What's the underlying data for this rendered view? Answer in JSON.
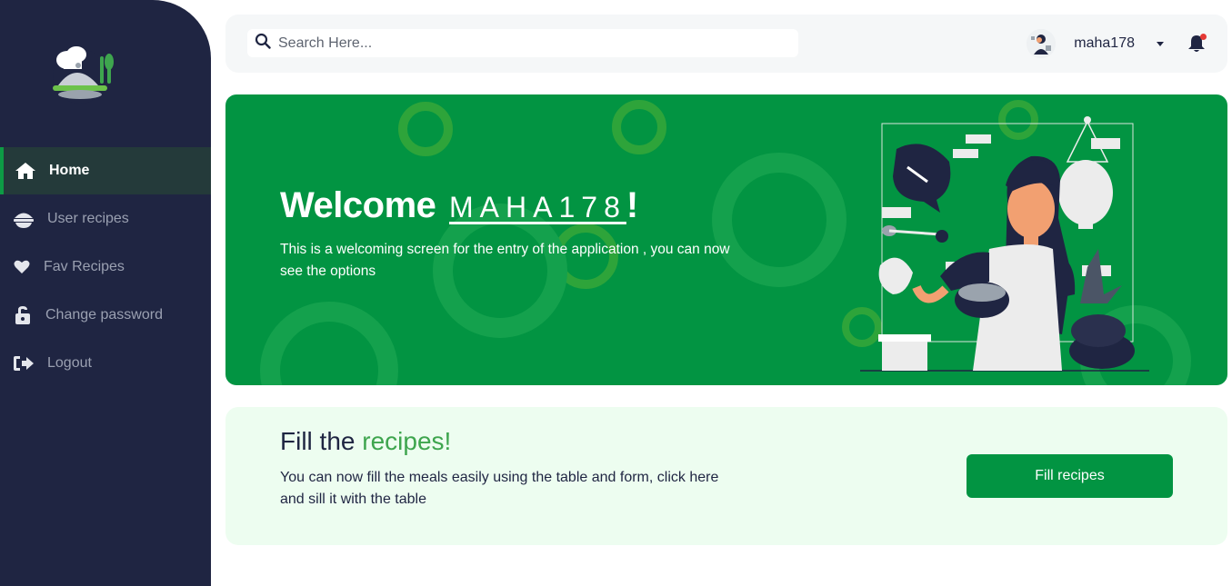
{
  "sidebar": {
    "items": [
      {
        "label": "Home",
        "icon": "home-icon",
        "active": true
      },
      {
        "label": "User recipes",
        "icon": "bowl-icon",
        "active": false
      },
      {
        "label": "Fav Recipes",
        "icon": "heart-icon",
        "active": false
      },
      {
        "label": "Change password",
        "icon": "unlock-icon",
        "active": false
      },
      {
        "label": "Logout",
        "icon": "logout-icon",
        "active": false
      }
    ]
  },
  "header": {
    "search_placeholder": "Search Here...",
    "username": "maha178"
  },
  "banner": {
    "welcome": "Welcome",
    "name": "MAHA178",
    "exclaim": "!",
    "description": "This is a welcoming screen for the entry of the application , you can now see the options"
  },
  "card": {
    "title_prefix": "Fill the ",
    "title_accent": "recipes!",
    "description": "You can now fill the meals easily using the table and form, click here and sill it with the table",
    "button_label": "Fill recipes"
  },
  "colors": {
    "sidebar_bg": "#1f2542",
    "primary_green": "#029442",
    "accent_green": "#3ea54e",
    "card_bg": "#edfdf0",
    "notification_dot": "#e53935"
  }
}
